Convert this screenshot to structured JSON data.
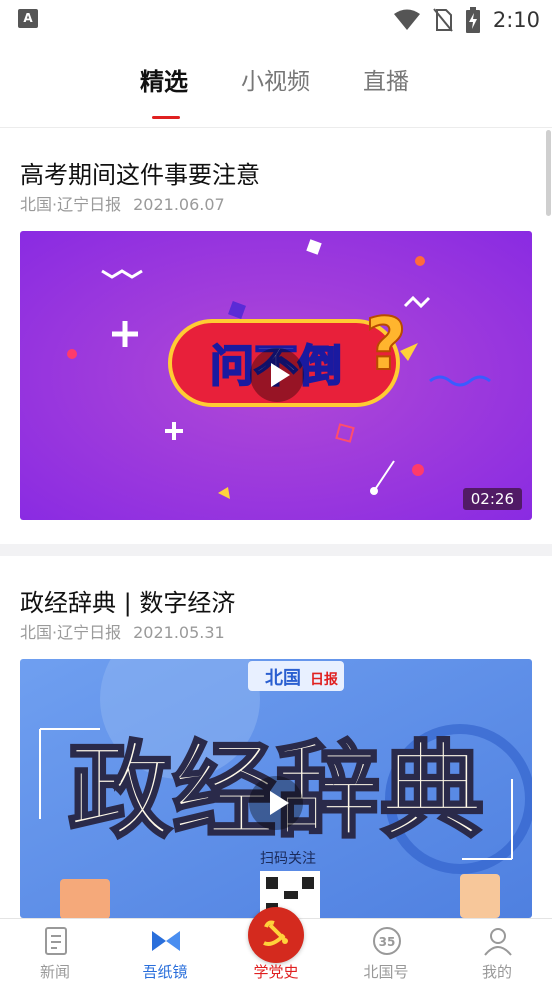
{
  "status_bar": {
    "app_badge": "A",
    "time": "2:10",
    "icons": [
      "wifi-icon",
      "no-sim-icon",
      "battery-charging-icon"
    ]
  },
  "tabs": [
    {
      "label": "精选",
      "active": true
    },
    {
      "label": "小视频",
      "active": false
    },
    {
      "label": "直播",
      "active": false
    }
  ],
  "feed": [
    {
      "title": "高考期间这件事要注意",
      "source": "北国·辽宁日报",
      "date": "2021.06.07",
      "duration": "02:26",
      "thumb_logo_text": "问不倒",
      "thumb_colors": [
        "#8a2be2",
        "#b14ad6"
      ]
    },
    {
      "title": "政经辞典 | 数字经济",
      "source": "北国·辽宁日报",
      "date": "2021.05.31",
      "thumb_header": "北国",
      "thumb_headline": "政经辞典",
      "thumb_caption": "扫码关注",
      "thumb_colors": [
        "#5a8de8",
        "#8fb5f2"
      ]
    }
  ],
  "bottom_nav": [
    {
      "label": "新闻",
      "icon": "newspaper-icon",
      "active": false
    },
    {
      "label": "吾纸镜",
      "icon": "bowtie-logo-icon",
      "active": true
    },
    {
      "label": "学党史",
      "icon": "party-emblem-icon",
      "active": false
    },
    {
      "label": "北国号",
      "icon": "beiguo-35-icon",
      "active": false
    },
    {
      "label": "我的",
      "icon": "user-icon",
      "active": false
    }
  ],
  "colors": {
    "accent_red": "#e02020",
    "nav_active_blue": "#2a6fdb"
  }
}
